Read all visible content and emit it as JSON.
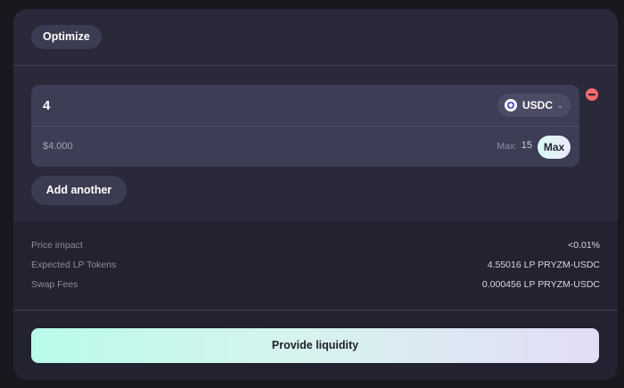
{
  "header": {
    "optimize_label": "Optimize"
  },
  "asset": {
    "amount": "4",
    "token_symbol": "USDC",
    "token_icon": "usdc-logo",
    "usd_value": "$4.000",
    "max_label": "Max:",
    "max_value": "15",
    "max_button_label": "Max"
  },
  "add_another_label": "Add another",
  "details": [
    {
      "label": "Price impact",
      "value": "<0.01%"
    },
    {
      "label": "Expected LP Tokens",
      "value": "4.55016 LP PRYZM-USDC"
    },
    {
      "label": "Swap Fees",
      "value": "0.000456 LP PRYZM-USDC"
    }
  ],
  "provide_label": "Provide liquidity",
  "colors": {
    "card_bg": "#292939",
    "input_bg": "#3d3d55",
    "remove_red": "#f06a6e",
    "button_gradient_start": "#b9fbeb",
    "button_gradient_end": "#e2ddf7"
  }
}
